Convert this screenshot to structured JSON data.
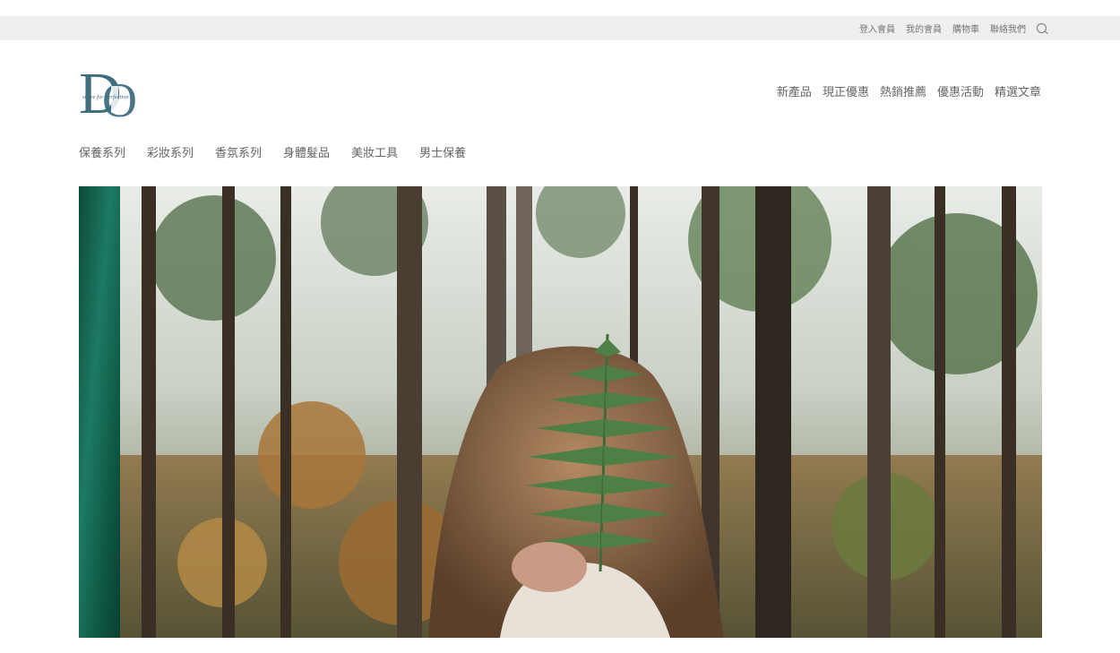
{
  "utility_nav": {
    "items": [
      "登入會員",
      "我的會員",
      "購物車",
      "聯絡我們"
    ],
    "search_icon": "search-icon"
  },
  "logo": {
    "letters": "DO",
    "tagline": "strive for perfection",
    "color": "#3f6e7f"
  },
  "main_nav": {
    "items": [
      "新產品",
      "現正優惠",
      "熱銷推薦",
      "優惠活動",
      "精選文章"
    ]
  },
  "category_nav": {
    "items": [
      "保養系列",
      "彩妝系列",
      "香氛系列",
      "身體髮品",
      "美妝工具",
      "男士保養"
    ]
  },
  "hero": {
    "accent_color": "#0f5a47",
    "alt": ""
  }
}
